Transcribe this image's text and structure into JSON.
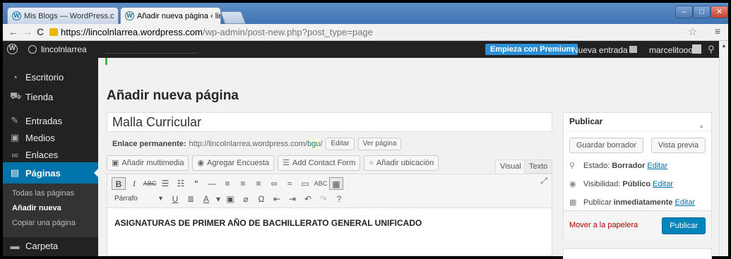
{
  "browser": {
    "tabs": [
      {
        "label": "Mis Blogs — WordPress.c"
      },
      {
        "label": "Añadir nueva página ‹ linc"
      }
    ],
    "tab_close": "×",
    "back": "←",
    "forward": "→",
    "reload": "C",
    "url_domain": "https://lincolnlarrea.wordpress.com",
    "url_path": "/wp-admin/post-new.php?post_type=page",
    "star": "☆",
    "menu": "≡",
    "win_min": "–",
    "win_max": "□",
    "win_close": "✕"
  },
  "adminbar": {
    "site_name": "lincolnlarrea",
    "premium": "Empieza con Premium",
    "new_entry": "Nueva entrada",
    "user": "marcelitooo"
  },
  "sidebar": {
    "items": [
      {
        "label": "Escritorio",
        "icon": "dashboard-icon",
        "glyph": "◔"
      },
      {
        "label": "Tienda",
        "icon": "cart-icon",
        "glyph": "⛟"
      },
      {
        "label": "Entradas",
        "icon": "pin-icon",
        "glyph": "✎"
      },
      {
        "label": "Medios",
        "icon": "media-icon",
        "glyph": "▣"
      },
      {
        "label": "Enlaces",
        "icon": "link-icon",
        "glyph": "∞"
      },
      {
        "label": "Páginas",
        "icon": "pages-icon",
        "glyph": "▤"
      },
      {
        "label": "Carpeta",
        "icon": "folder-icon",
        "glyph": "▬"
      }
    ],
    "submenu": [
      "Todas las páginas",
      "Añadir nueva",
      "Copiar una página"
    ]
  },
  "main": {
    "title": "Añadir nueva página",
    "post_title": "Malla Curricular",
    "permalink_label": "Enlace permanente:",
    "permalink_base": "http://lincolnlarrea.wordpress.com/",
    "permalink_slug": "bgu",
    "permalink_end": "/",
    "edit_btn": "Editar",
    "view_btn": "Ver página",
    "media_buttons": [
      "Añadir multimedia",
      "Agregar Encuesta",
      "Add Contact Form",
      "Añadir ubicación"
    ],
    "tab_visual": "Visual",
    "tab_text": "Texto",
    "format_select": "Párrafo",
    "content": "ASIGNATURAS DE PRIMER AÑO DE BACHILLERATO GENERAL UNIFICADO"
  },
  "publish": {
    "heading": "Publicar",
    "save_draft": "Guardar borrador",
    "preview": "Vista previa",
    "status_label": "Estado:",
    "status_value": "Borrador",
    "visibility_label": "Visibilidad:",
    "visibility_value": "Público",
    "schedule_label": "Publicar",
    "schedule_value": "inmediatamente",
    "edit_link": "Editar",
    "trash": "Mover a la papelera",
    "publish_btn": "Publicar"
  },
  "colors": {
    "admin_bar": "#222222",
    "accent": "#0073aa",
    "primary_button": "#0085ba",
    "premium_button": "#2b8fd6",
    "trash_link": "#aa0000"
  }
}
